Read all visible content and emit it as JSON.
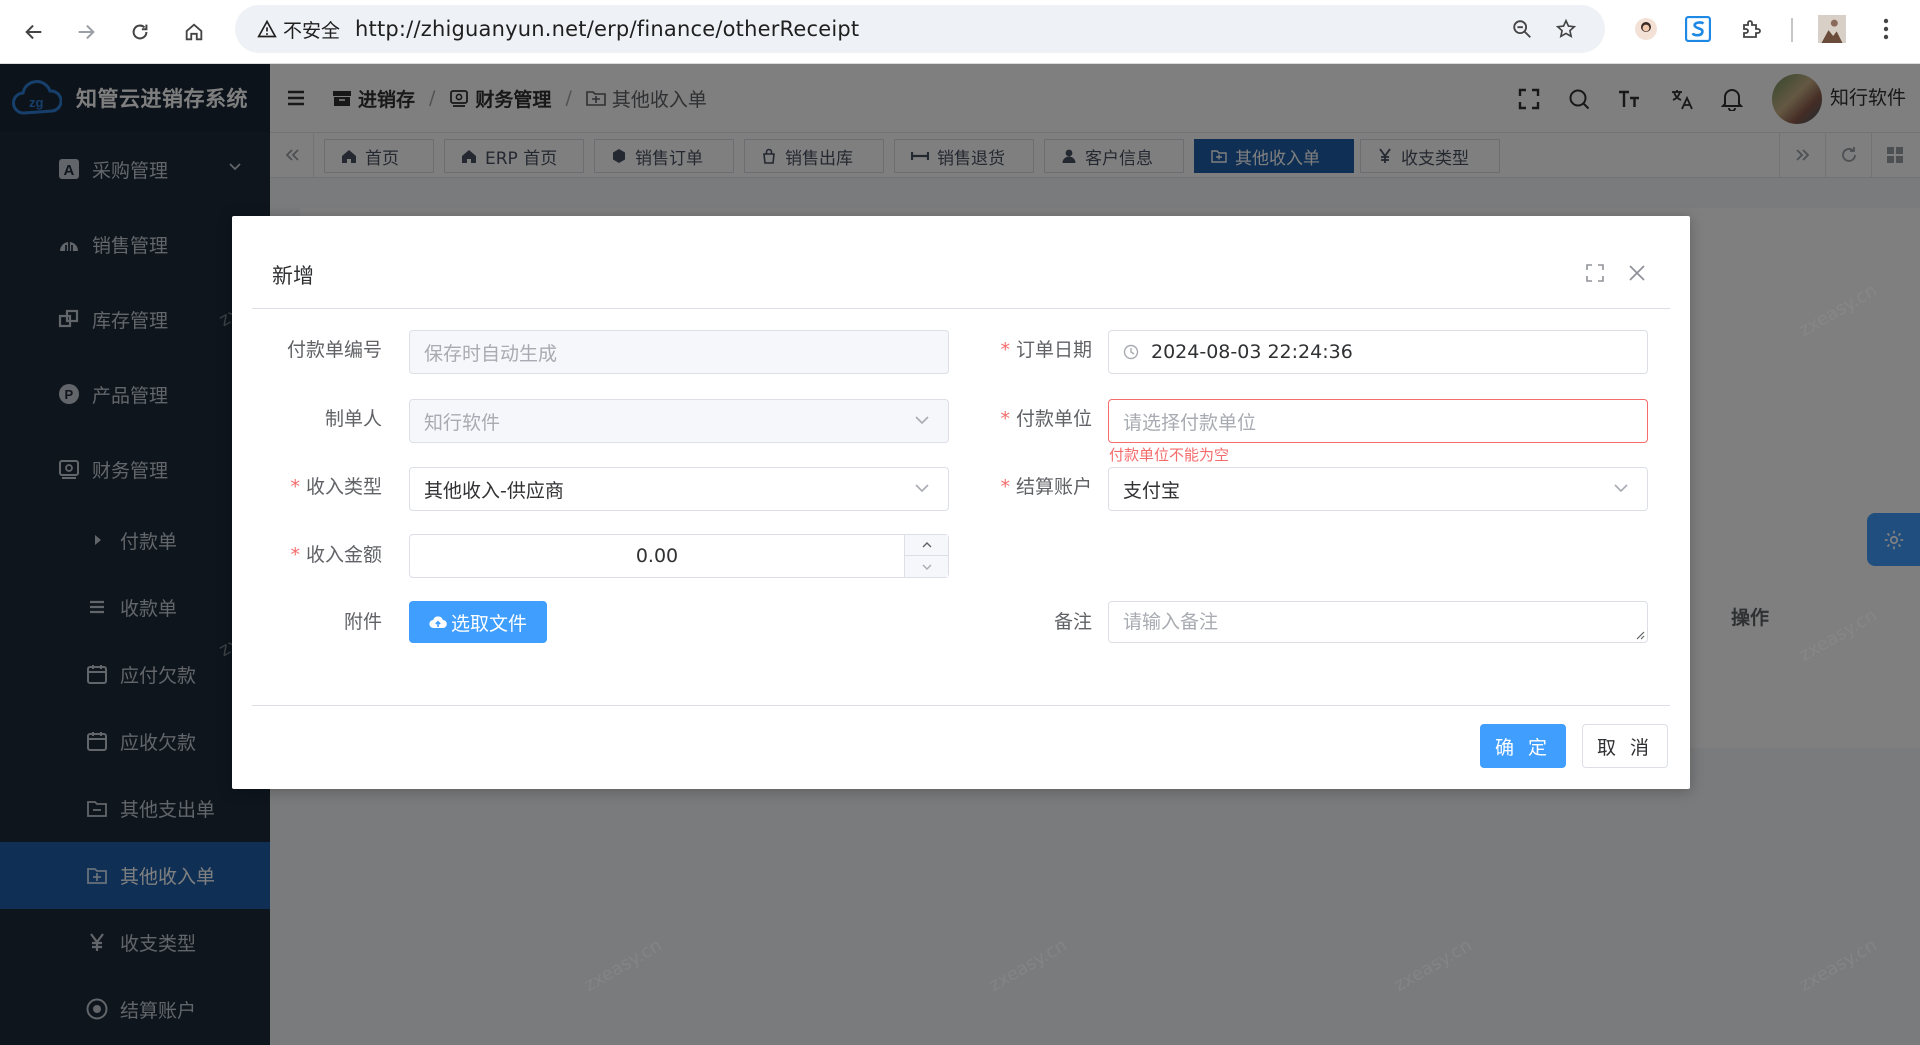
{
  "browser": {
    "security_label": "不安全",
    "url": "http://zhiguanyun.net/erp/finance/otherReceipt"
  },
  "sidebar": {
    "app_name": "知管云进销存系统",
    "menus": [
      {
        "label": "采购管理",
        "icon": "purchase-icon"
      },
      {
        "label": "销售管理",
        "icon": "sales-icon"
      },
      {
        "label": "库存管理",
        "icon": "stock-icon"
      },
      {
        "label": "产品管理",
        "icon": "product-icon"
      },
      {
        "label": "财务管理",
        "icon": "finance-icon"
      }
    ],
    "sub_items": [
      {
        "label": "付款单",
        "icon": "caret-right-icon"
      },
      {
        "label": "收款单",
        "icon": "list-icon"
      },
      {
        "label": "应付欠款",
        "icon": "calendar-icon"
      },
      {
        "label": "应收欠款",
        "icon": "calendar-icon"
      },
      {
        "label": "其他支出单",
        "icon": "folder-icon"
      },
      {
        "label": "其他收入单",
        "icon": "folder-plus-icon",
        "active": true
      },
      {
        "label": "收支类型",
        "icon": "yen-icon"
      },
      {
        "label": "结算账户",
        "icon": "account-icon"
      }
    ]
  },
  "header": {
    "breadcrumb": [
      "进销存",
      "财务管理",
      "其他收入单"
    ],
    "username": "知行软件"
  },
  "tabs": [
    {
      "label": "首页",
      "icon": "home-icon"
    },
    {
      "label": "ERP 首页",
      "icon": "home-icon"
    },
    {
      "label": "销售订单",
      "icon": "box-icon"
    },
    {
      "label": "销售出库",
      "icon": "bag-icon"
    },
    {
      "label": "销售退货",
      "icon": "swap-icon"
    },
    {
      "label": "客户信息",
      "icon": "user-icon"
    },
    {
      "label": "其他收入单",
      "icon": "folder-plus-icon",
      "active": true
    },
    {
      "label": "收支类型",
      "icon": "yen-icon"
    }
  ],
  "background": {
    "operation_header": "操作"
  },
  "dialog": {
    "title": "新增",
    "fields": {
      "payment_no": {
        "label": "付款单编号",
        "placeholder": "保存时自动生成"
      },
      "order_date": {
        "label": "订单日期",
        "value": "2024-08-03 22:24:36",
        "required": true
      },
      "creator": {
        "label": "制单人",
        "value": "知行软件"
      },
      "payer": {
        "label": "付款单位",
        "placeholder": "请选择付款单位",
        "error": "付款单位不能为空",
        "required": true
      },
      "income_type": {
        "label": "收入类型",
        "value": "其他收入-供应商",
        "required": true
      },
      "account": {
        "label": "结算账户",
        "value": "支付宝",
        "required": true
      },
      "amount": {
        "label": "收入金额",
        "value": "0.00",
        "required": true
      },
      "attachment": {
        "label": "附件",
        "button": "选取文件"
      },
      "remark": {
        "label": "备注",
        "placeholder": "请输入备注"
      }
    },
    "confirm": "确 定",
    "cancel": "取 消"
  },
  "watermark": "zxeasy.cn",
  "colors": {
    "primary": "#409eff",
    "sidebar": "#1d2b3a",
    "active_menu": "#1f5ea8",
    "error": "#f56c6c"
  }
}
